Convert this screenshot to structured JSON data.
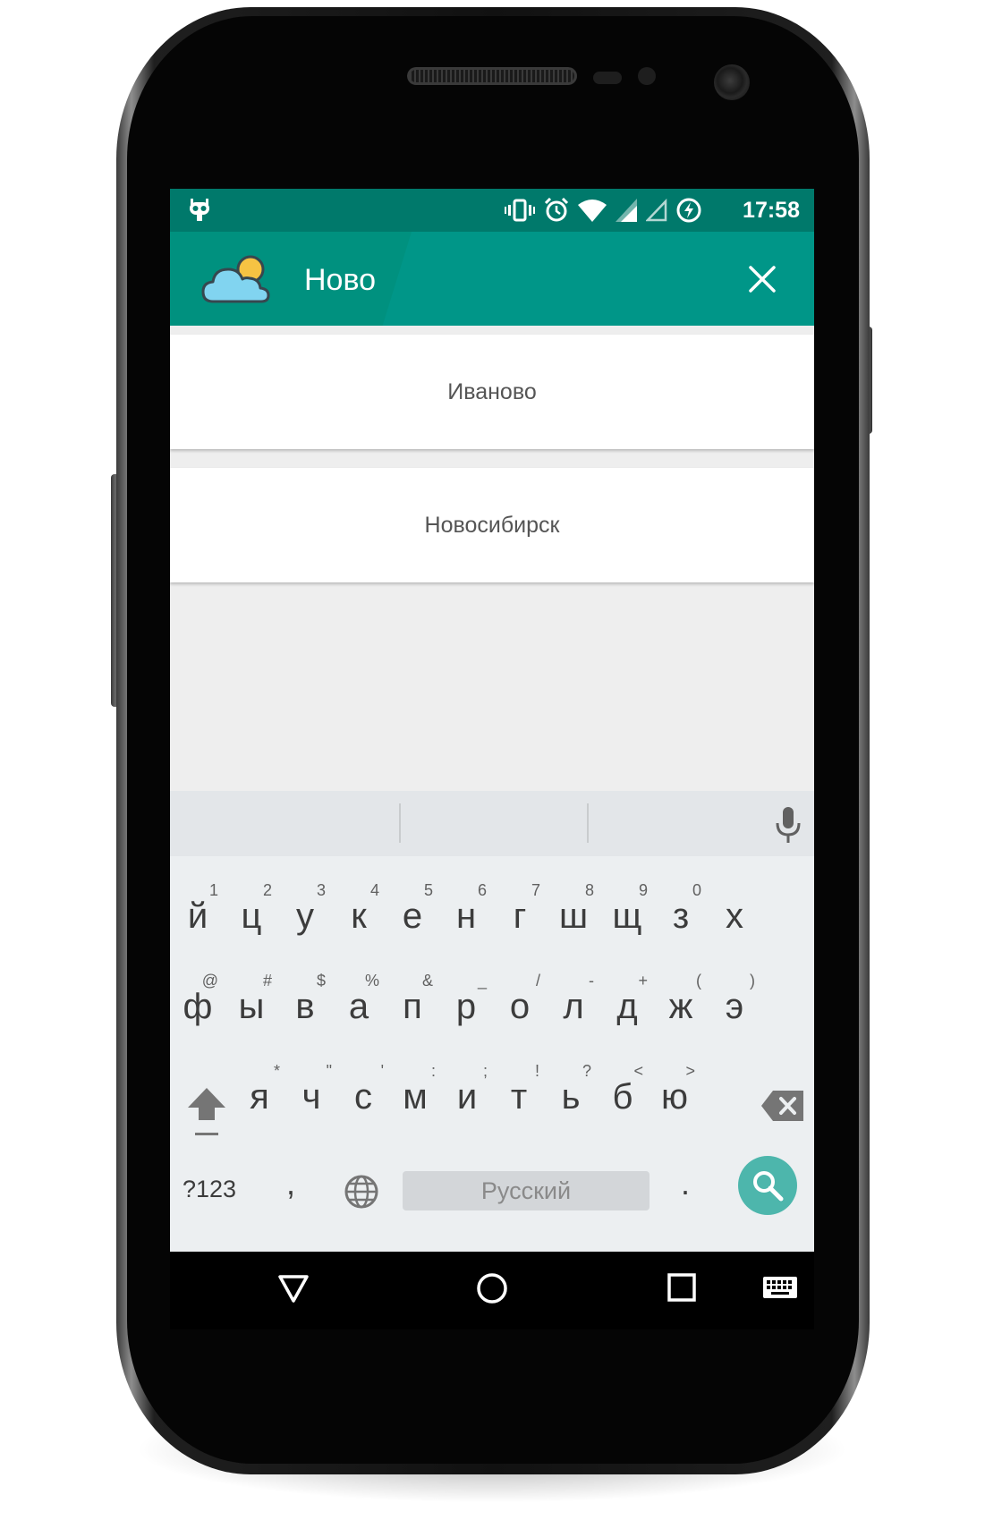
{
  "status_bar": {
    "time": "17:58",
    "icons": [
      "cyanogen-robot-icon",
      "vibrate-icon",
      "alarm-icon",
      "wifi-icon",
      "signal-icon",
      "signal-empty-icon",
      "battery-charging-icon"
    ]
  },
  "app_bar": {
    "logo_icon": "cloud-sun-icon",
    "search_query": "Ново",
    "close_icon": "close-icon",
    "color": "#009688"
  },
  "results": [
    {
      "label": "Иваново"
    },
    {
      "label": "Новосибирск"
    }
  ],
  "keyboard": {
    "row1": [
      {
        "key": "й",
        "hint": "1"
      },
      {
        "key": "ц",
        "hint": "2"
      },
      {
        "key": "у",
        "hint": "3"
      },
      {
        "key": "к",
        "hint": "4"
      },
      {
        "key": "е",
        "hint": "5"
      },
      {
        "key": "н",
        "hint": "6"
      },
      {
        "key": "г",
        "hint": "7"
      },
      {
        "key": "ш",
        "hint": "8"
      },
      {
        "key": "щ",
        "hint": "9"
      },
      {
        "key": "з",
        "hint": "0"
      },
      {
        "key": "х",
        "hint": ""
      }
    ],
    "row2": [
      {
        "key": "ф",
        "hint": "@"
      },
      {
        "key": "ы",
        "hint": "#"
      },
      {
        "key": "в",
        "hint": "$"
      },
      {
        "key": "а",
        "hint": "%"
      },
      {
        "key": "п",
        "hint": "&"
      },
      {
        "key": "р",
        "hint": "_"
      },
      {
        "key": "о",
        "hint": "/"
      },
      {
        "key": "л",
        "hint": "-"
      },
      {
        "key": "д",
        "hint": "+"
      },
      {
        "key": "ж",
        "hint": "("
      },
      {
        "key": "э",
        "hint": ")"
      }
    ],
    "row3": [
      {
        "key": "я",
        "hint": "*"
      },
      {
        "key": "ч",
        "hint": "\""
      },
      {
        "key": "с",
        "hint": "'"
      },
      {
        "key": "м",
        "hint": ":"
      },
      {
        "key": "и",
        "hint": ";"
      },
      {
        "key": "т",
        "hint": "!"
      },
      {
        "key": "ь",
        "hint": "?"
      },
      {
        "key": "б",
        "hint": "<"
      },
      {
        "key": "ю",
        "hint": ">"
      }
    ],
    "symbols_label": "?123",
    "comma": ",",
    "space_label": "Русский",
    "period": ".",
    "action_color": "#4db6ac"
  },
  "nav_bar": {
    "icons": [
      "back-icon",
      "home-icon",
      "recents-icon",
      "keyboard-icon"
    ]
  }
}
